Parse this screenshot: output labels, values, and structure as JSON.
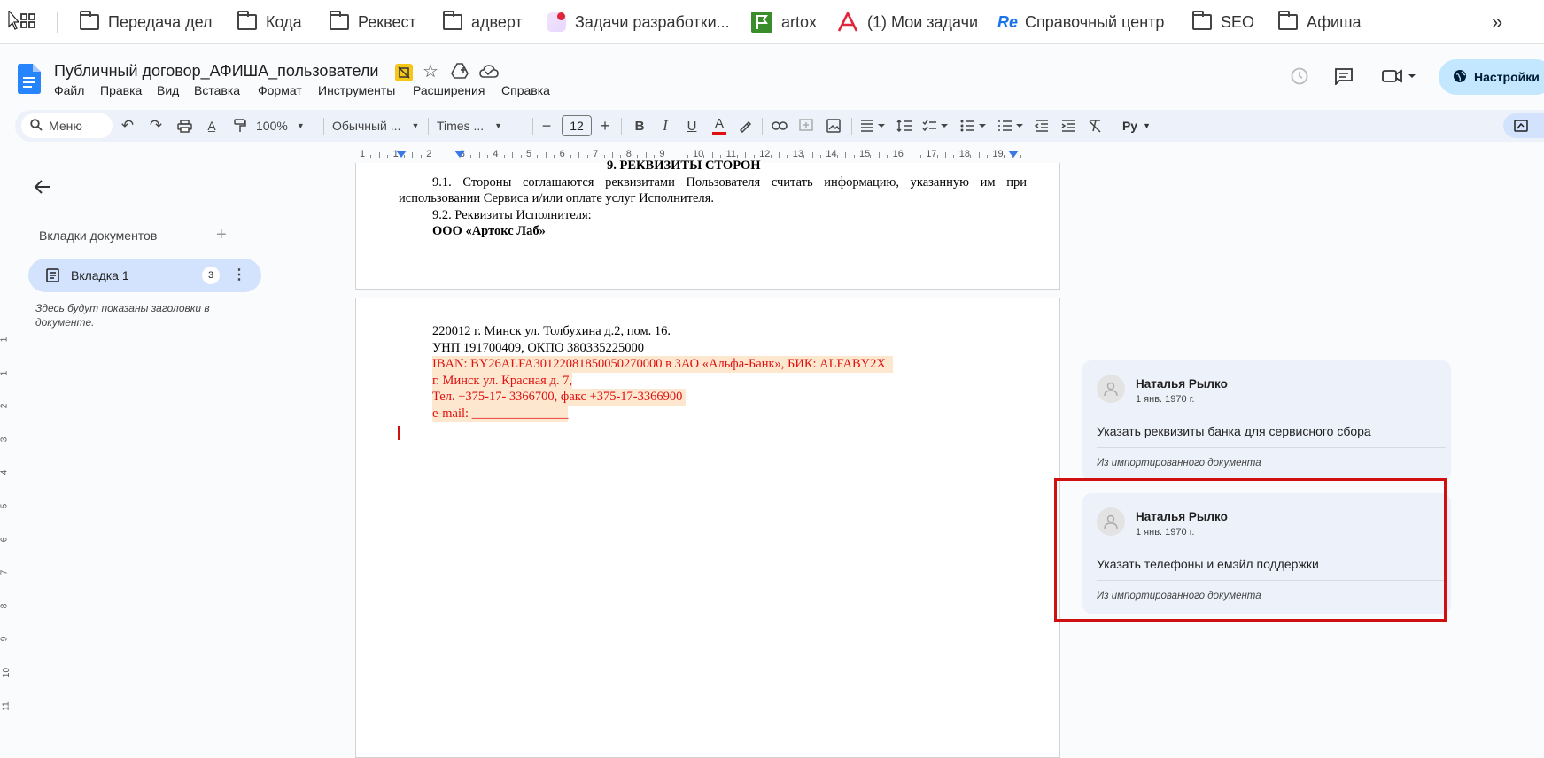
{
  "bookmarks": [
    {
      "label": "Передача дел",
      "icon": "folder-icon"
    },
    {
      "label": "Кода",
      "icon": "folder-icon"
    },
    {
      "label": "Реквест",
      "icon": "folder-icon"
    },
    {
      "label": "адверт",
      "icon": "folder-icon"
    },
    {
      "label": "Задачи разработки...",
      "icon": "app-icon"
    },
    {
      "label": "artox",
      "icon": "flag-icon"
    },
    {
      "label": "(1) Мои задачи",
      "icon": "asana-icon"
    },
    {
      "label": "Справочный центр",
      "icon": "re-icon",
      "icon_text": "Re"
    },
    {
      "label": "SEO",
      "icon": "folder-icon"
    },
    {
      "label": "Афиша",
      "icon": "folder-icon"
    }
  ],
  "doc": {
    "title": "Публичный договор_АФИША_пользователи",
    "menu": [
      "Файл",
      "Правка",
      "Вид",
      "Вставка",
      "Формат",
      "Инструменты",
      "Расширения",
      "Справка"
    ],
    "share_label": "Настройки"
  },
  "toolbar": {
    "search_label": "Меню",
    "zoom": "100%",
    "style": "Обычный ...",
    "font": "Times ...",
    "font_size": "12",
    "text_color": "#e01010",
    "input_tools": "Py"
  },
  "ruler": {
    "h_ticks": [
      "1",
      "1",
      "2",
      "3",
      "4",
      "5",
      "6",
      "7",
      "8",
      "9",
      "10",
      "11",
      "12",
      "13",
      "14",
      "15",
      "16",
      "17",
      "18",
      "19"
    ],
    "v_ticks": [
      "1",
      "1",
      "2",
      "3",
      "4",
      "5",
      "6",
      "7",
      "8",
      "9",
      "10",
      "11"
    ]
  },
  "sidebar": {
    "heading": "Вкладки документов",
    "tab_label": "Вкладка 1",
    "tab_badge": "3",
    "hint": "Здесь будут показаны заголовки в документе."
  },
  "page1": {
    "heading": "9.   РЕКВИЗИТЫ СТОРОН",
    "p1_line1": "9.1.  Стороны  соглашаются  реквизитами  Пользователя  считать  информацию,  указанную  им  при",
    "p1_line2": "использовании Сервиса и/или оплате услуг Исполнителя.",
    "p2": "9.2.  Реквизиты Исполнителя:",
    "company": "ООО «Артокс Лаб»"
  },
  "page2": {
    "line1": "220012 г. Минск ул. Толбухина д.2, пом. 16.",
    "line2": "УНП 191700409, ОКПО 380335225000",
    "line3": "IBAN: BY26ALFA30122081850050270000 в ЗАО «Альфа-Банк», БИК: ALFABY2X",
    "line4": "г. Минск ул. Красная д. 7,",
    "line5": "Тел. +375-17- 3366700, факс +375-17-3366900",
    "line6": "e-mail: _______________"
  },
  "comments": [
    {
      "author": "Наталья Рылко",
      "date": "1 янв. 1970 г.",
      "text": "Указать реквизиты банка для сервисного сбора",
      "source": "Из импортированного документа"
    },
    {
      "author": "Наталья Рылко",
      "date": "1 янв. 1970 г.",
      "text": "Указать телефоны и емэйл поддержки",
      "source": "Из импортированного документа"
    }
  ],
  "colors": {
    "highlight_box": "#d01010",
    "accent_blue": "#0b57d0",
    "comment_bg": "#edf2fa"
  }
}
